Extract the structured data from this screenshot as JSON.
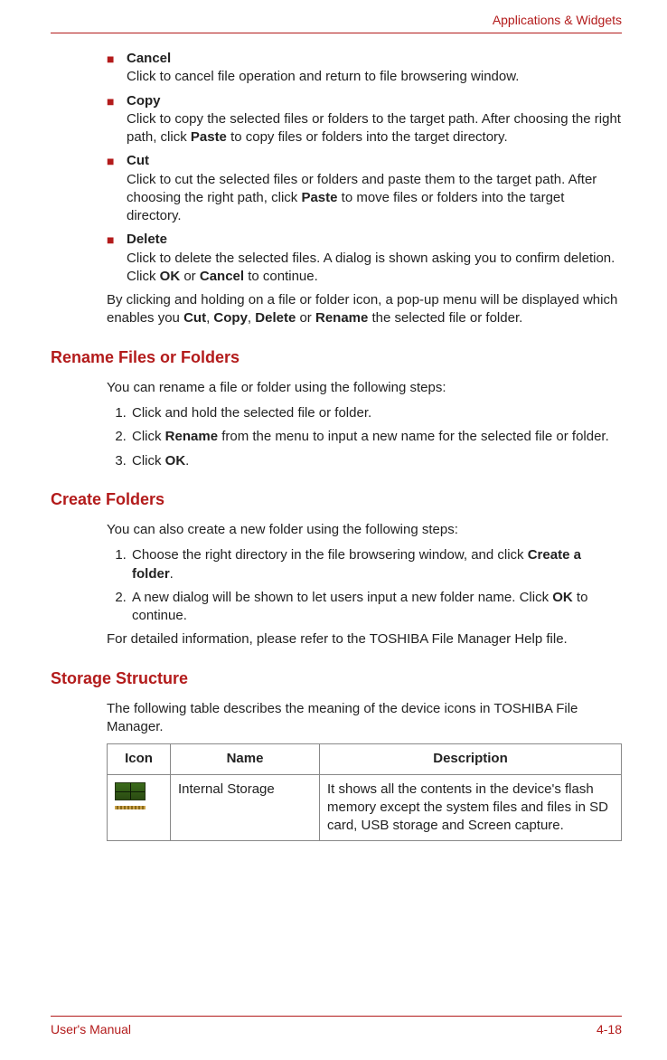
{
  "header": {
    "section": "Applications & Widgets"
  },
  "bullets": [
    {
      "term": "Cancel",
      "desc_plain": "Click to cancel file operation and return to file browsering window.",
      "bold_terms": []
    },
    {
      "term": "Copy",
      "desc_plain": "Click to copy the selected files or folders to the target path. After choosing the right path, click Paste to copy files or folders into the target directory.",
      "bold_terms": [
        "Paste"
      ]
    },
    {
      "term": "Cut",
      "desc_plain": "Click to cut the selected files or folders and paste them to the target path. After choosing the right path, click Paste to move files or folders into the target directory.",
      "bold_terms": [
        "Paste"
      ]
    },
    {
      "term": "Delete",
      "desc_plain": "Click to delete the selected files. A dialog is shown asking you to confirm deletion. Click OK or Cancel to continue.",
      "bold_terms": [
        "OK",
        "Cancel"
      ]
    }
  ],
  "after_bullets": {
    "text": "By clicking and holding on a file or folder icon, a pop-up menu will be displayed which enables you Cut, Copy, Delete or Rename the selected file or folder.",
    "bold_terms": [
      "Cut",
      "Copy",
      "Delete",
      "Rename"
    ]
  },
  "rename": {
    "heading": "Rename Files or Folders",
    "intro": "You can rename a file or folder using the following steps:",
    "steps": [
      {
        "text": "Click and hold the selected file or folder.",
        "bold_terms": []
      },
      {
        "text": "Click Rename from the menu to input a new name for the selected file or folder.",
        "bold_terms": [
          "Rename"
        ]
      },
      {
        "text": "Click OK.",
        "bold_terms": [
          "OK"
        ]
      }
    ]
  },
  "create": {
    "heading": "Create Folders",
    "intro": "You can also create a new folder using the following steps:",
    "steps": [
      {
        "text": "Choose the right directory in the file browsering window, and click Create a folder.",
        "bold_terms": [
          "Create a folder"
        ]
      },
      {
        "text": "A new dialog will be shown to let users input a new folder name. Click OK to continue.",
        "bold_terms": [
          "OK"
        ]
      }
    ],
    "outro": "For detailed information, please refer to the TOSHIBA File Manager Help file."
  },
  "storage": {
    "heading": "Storage Structure",
    "intro": "The following table describes the meaning of the device icons in TOSHIBA File Manager.",
    "columns": [
      "Icon",
      "Name",
      "Description"
    ],
    "rows": [
      {
        "icon": "memory-chip-icon",
        "name": "Internal Storage",
        "desc": "It shows all the contents in the device's flash memory except the system files and files in SD card, USB storage and Screen capture."
      }
    ]
  },
  "footer": {
    "left": "User's Manual",
    "right": "4-18"
  }
}
